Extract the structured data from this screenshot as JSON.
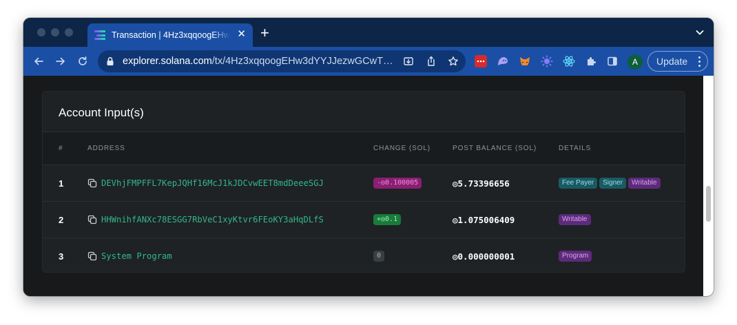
{
  "browser": {
    "tab_title": "Transaction | 4Hz3xqqoogEHw3dYYJJezwGCwT",
    "tab_close": "✕",
    "new_tab": "+",
    "url_host": "explorer.solana.com",
    "url_path": "/tx/4Hz3xqqoogEHw3dYYJJezwGCwT…",
    "avatar_letter": "A",
    "update_label": "Update",
    "colors": {
      "tab_strip": "#0d2647",
      "toolbar": "#1a4fa5",
      "omnibox": "#0f3673"
    }
  },
  "card": {
    "title": "Account Input(s)",
    "columns": [
      "#",
      "ADDRESS",
      "CHANGE (SOL)",
      "POST BALANCE (SOL)",
      "DETAILS"
    ],
    "rows": [
      {
        "index": "1",
        "address": "DEVhjFMPFFL7KepJQHf16McJ1kJDCvwEET8mdDeeeSGJ",
        "change": "-◎0.100005",
        "change_kind": "negative",
        "balance": "◎5.73396656",
        "details": [
          "Fee Payer",
          "Signer",
          "Writable"
        ]
      },
      {
        "index": "2",
        "address": "HHWnihfANXc78ESGG7RbVeC1xyKtvr6FEoKY3aHqDLfS",
        "change": "+◎0.1",
        "change_kind": "positive",
        "balance": "◎1.075006409",
        "details": [
          "Writable"
        ]
      },
      {
        "index": "3",
        "address": "System Program",
        "change": "0",
        "change_kind": "zero",
        "balance": "◎0.000000001",
        "details": [
          "Program"
        ]
      }
    ]
  },
  "theme": {
    "page_bg": "#17191b",
    "card_bg": "#1e2224",
    "address_color": "#33b787"
  }
}
